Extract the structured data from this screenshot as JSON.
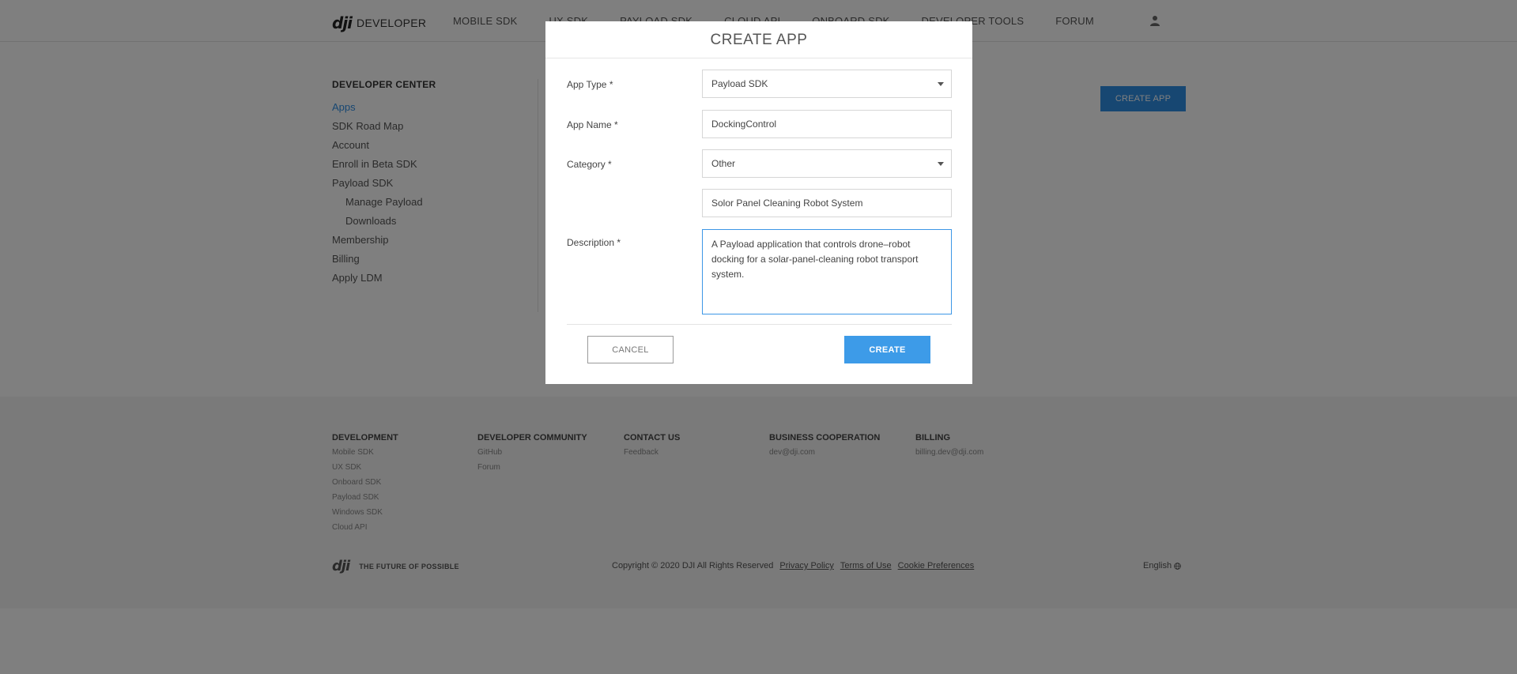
{
  "nav": {
    "logo_mark": "dji",
    "logo_text": "DEVELOPER",
    "links": [
      "MOBILE SDK",
      "UX SDK",
      "PAYLOAD SDK",
      "CLOUD API",
      "ONBOARD SDK",
      "DEVELOPER TOOLS",
      "FORUM"
    ],
    "user_icon": "user-icon"
  },
  "sidebar": {
    "title": "DEVELOPER CENTER",
    "items": [
      "Apps",
      "SDK Road Map",
      "Account",
      "Enroll in Beta SDK",
      "Payload SDK",
      "Manage Payload",
      "Downloads",
      "Membership",
      "Billing",
      "Apply LDM"
    ]
  },
  "main": {
    "create_app_label": "CREATE APP"
  },
  "modal": {
    "title": "CREATE APP",
    "app_type_label": "App Type *",
    "app_type_value": "Payload SDK",
    "app_name_label": "App Name *",
    "app_name_value": "DockingControl",
    "category_label": "Category *",
    "category_value": "Other",
    "other_category_value": "Solor Panel Cleaning Robot System",
    "description_label": "Description *",
    "description_value": "A Payload application that controls drone–robot docking for a solar-panel-cleaning robot transport system.",
    "cancel_label": "CANCEL",
    "create_label": "CREATE"
  },
  "footer": {
    "development": {
      "title": "DEVELOPMENT",
      "links": [
        "Mobile SDK",
        "UX SDK",
        "Onboard SDK",
        "Payload SDK",
        "Windows SDK",
        "Cloud API"
      ]
    },
    "community": {
      "title": "DEVELOPER COMMUNITY",
      "links": [
        "GitHub",
        "Forum"
      ]
    },
    "contact": {
      "title": "CONTACT US",
      "links": [
        "Feedback"
      ]
    },
    "business": {
      "title": "BUSINESS COOPERATION",
      "links": [
        "dev@dji.com"
      ]
    },
    "billing": {
      "title": "BILLING",
      "links": [
        "billing.dev@dji.com"
      ]
    },
    "slogan": "THE FUTURE OF POSSIBLE",
    "copyright": "Copyright © 2020 DJI All Rights Reserved",
    "privacy": "Privacy Policy",
    "terms": "Terms of Use",
    "cookies": "Cookie Preferences",
    "language": "English"
  },
  "colors": {
    "accent": "#3d9be8",
    "overlay": "rgba(0,0,0,0.5)"
  }
}
